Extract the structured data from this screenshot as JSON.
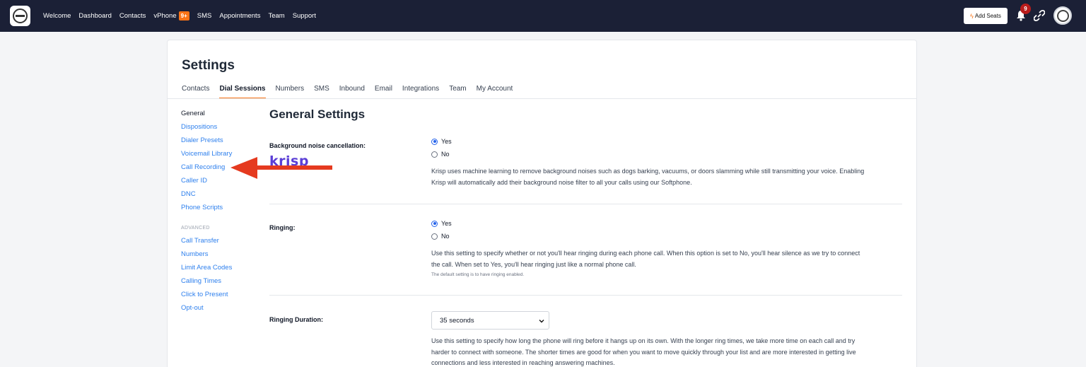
{
  "nav": {
    "links": [
      "Welcome",
      "Dashboard",
      "Contacts",
      "vPhone",
      "SMS",
      "Appointments",
      "Team",
      "Support"
    ],
    "vphone_badge": "9+",
    "add_seats": "Add Seats",
    "notifications_count": "9"
  },
  "page": {
    "title": "Settings",
    "tabs": [
      "Contacts",
      "Dial Sessions",
      "Numbers",
      "SMS",
      "Inbound",
      "Email",
      "Integrations",
      "Team",
      "My Account"
    ],
    "active_tab": "Dial Sessions"
  },
  "sidebar": {
    "items": [
      "General",
      "Dispositions",
      "Dialer Presets",
      "Voicemail Library",
      "Call Recording",
      "Caller ID",
      "DNC",
      "Phone Scripts"
    ],
    "advanced_header": "ADVANCED",
    "advanced_items": [
      "Call Transfer",
      "Numbers",
      "Limit Area Codes",
      "Calling Times",
      "Click to Present",
      "Opt-out"
    ],
    "active_item": "General"
  },
  "main": {
    "section_title": "General Settings",
    "noise": {
      "label": "Background noise cancellation:",
      "logo_text": "krisp",
      "option_yes": "Yes",
      "option_no": "No",
      "selected": "Yes",
      "description_1": "Krisp uses machine learning to remove background noises such as dogs barking, vacuums, or doors slamming while still transmitting your voice. Enabling",
      "description_2": "Krisp will automatically add their background noise filter to all your calls using our Softphone."
    },
    "ringing": {
      "label": "Ringing:",
      "option_yes": "Yes",
      "option_no": "No",
      "selected": "Yes",
      "description_1": "Use this setting to specify whether or not you'll hear ringing during each phone call. When this option is set to No, you'll hear silence as we try to connect",
      "description_2": "the call. When set to Yes, you'll hear ringing just like a normal phone call.",
      "note": "The default setting is to have ringing enabled."
    },
    "ringing_duration": {
      "label": "Ringing Duration:",
      "value": "35 seconds",
      "description_1": "Use this setting to specify how long the phone will ring before it hangs up on its own. With the longer ring times, we take more time on each call and try",
      "description_2": "harder to connect with someone. The shorter times are good for when you want to move quickly through your list and are more interested in getting live",
      "description_3": "connections and less interested in reaching answering machines."
    }
  },
  "colors": {
    "nav_bg": "#1b2036",
    "accent": "#f97316",
    "link": "#2f80ed",
    "arrow": "#e53a1f"
  }
}
